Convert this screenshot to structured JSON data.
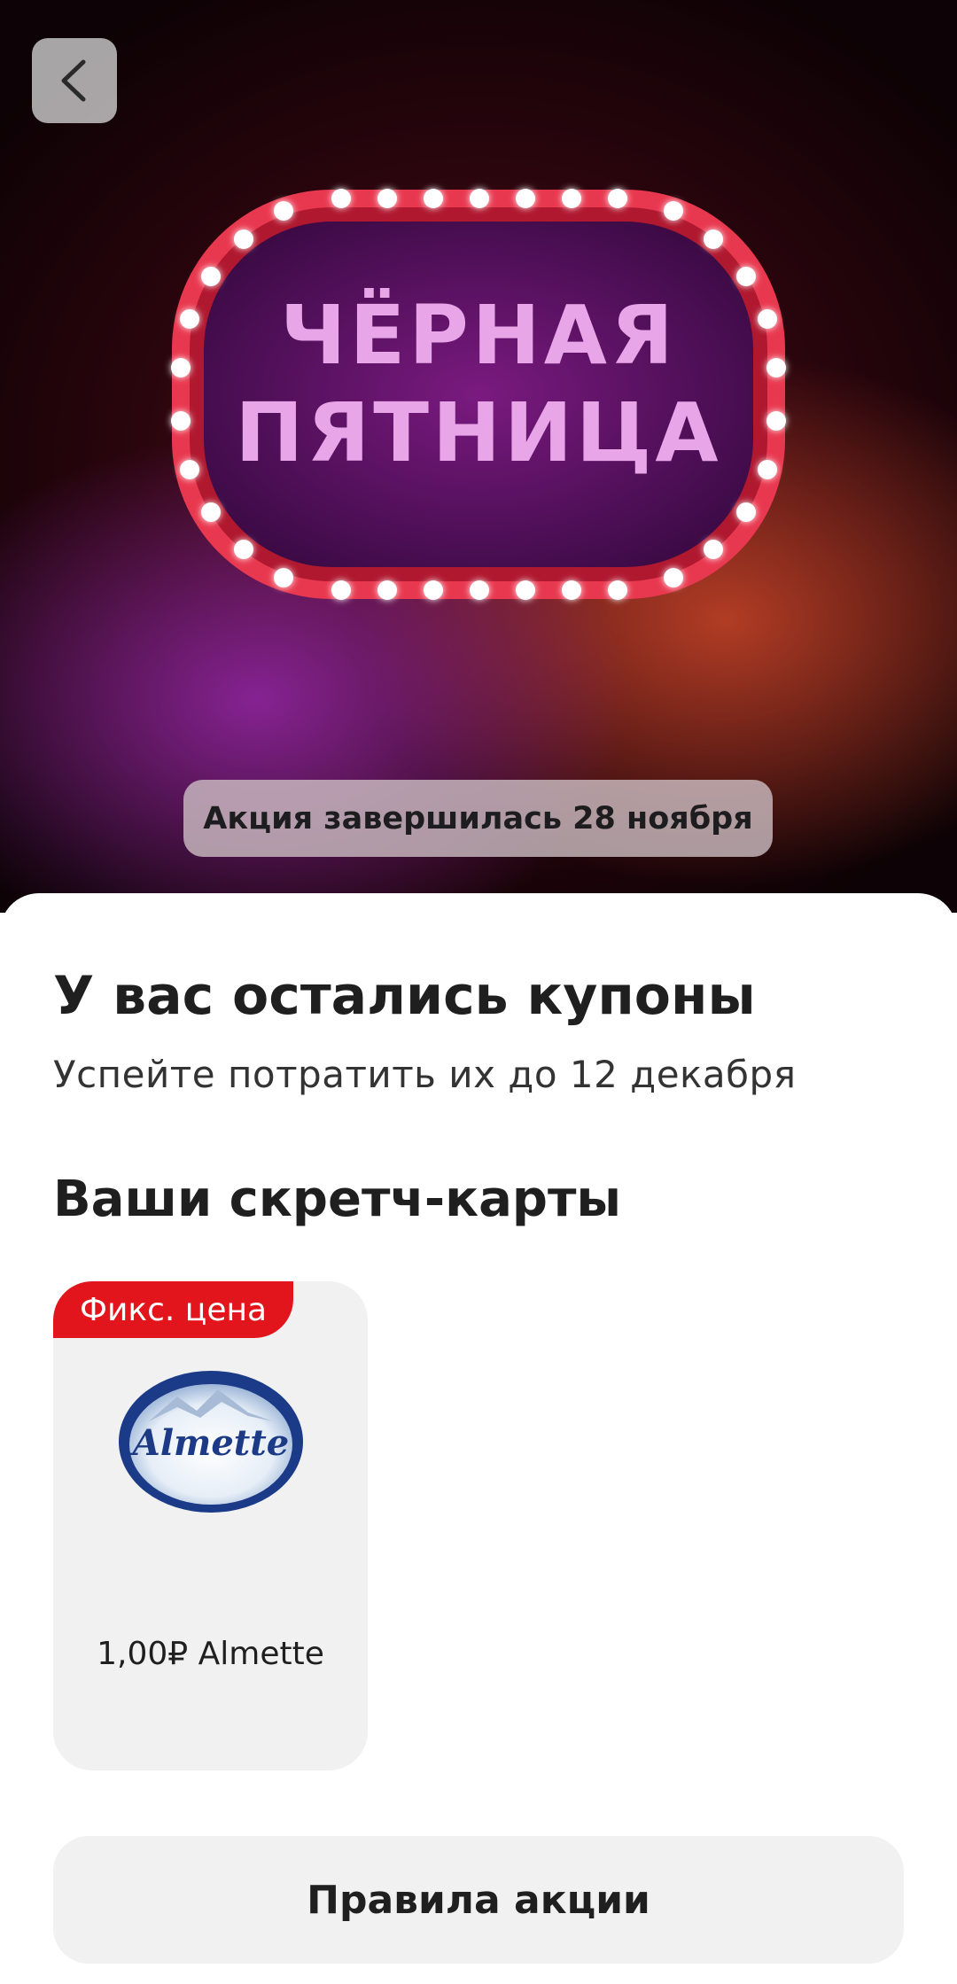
{
  "hero": {
    "back_icon": "chevron-left-icon",
    "banner": {
      "line1": "ЧЁРНАЯ",
      "line2": "ПЯТНИЦА"
    },
    "ended_badge": "Акция завершилась 28 ноября"
  },
  "sheet": {
    "title": "У вас остались купоны",
    "subtitle": "Успейте потратить их до 12 декабря",
    "section_title": "Ваши скретч-карты",
    "cards": [
      {
        "tag": "Фикс. цена",
        "logo_text": "Almette",
        "label": "1,00₽ Almette"
      }
    ],
    "rules_button": "Правила акции"
  },
  "colors": {
    "tag_red": "#e3151c",
    "banner_text": "#e8a6e8",
    "banner_frame": "#e8384f",
    "card_bg": "#f1f1f1"
  }
}
